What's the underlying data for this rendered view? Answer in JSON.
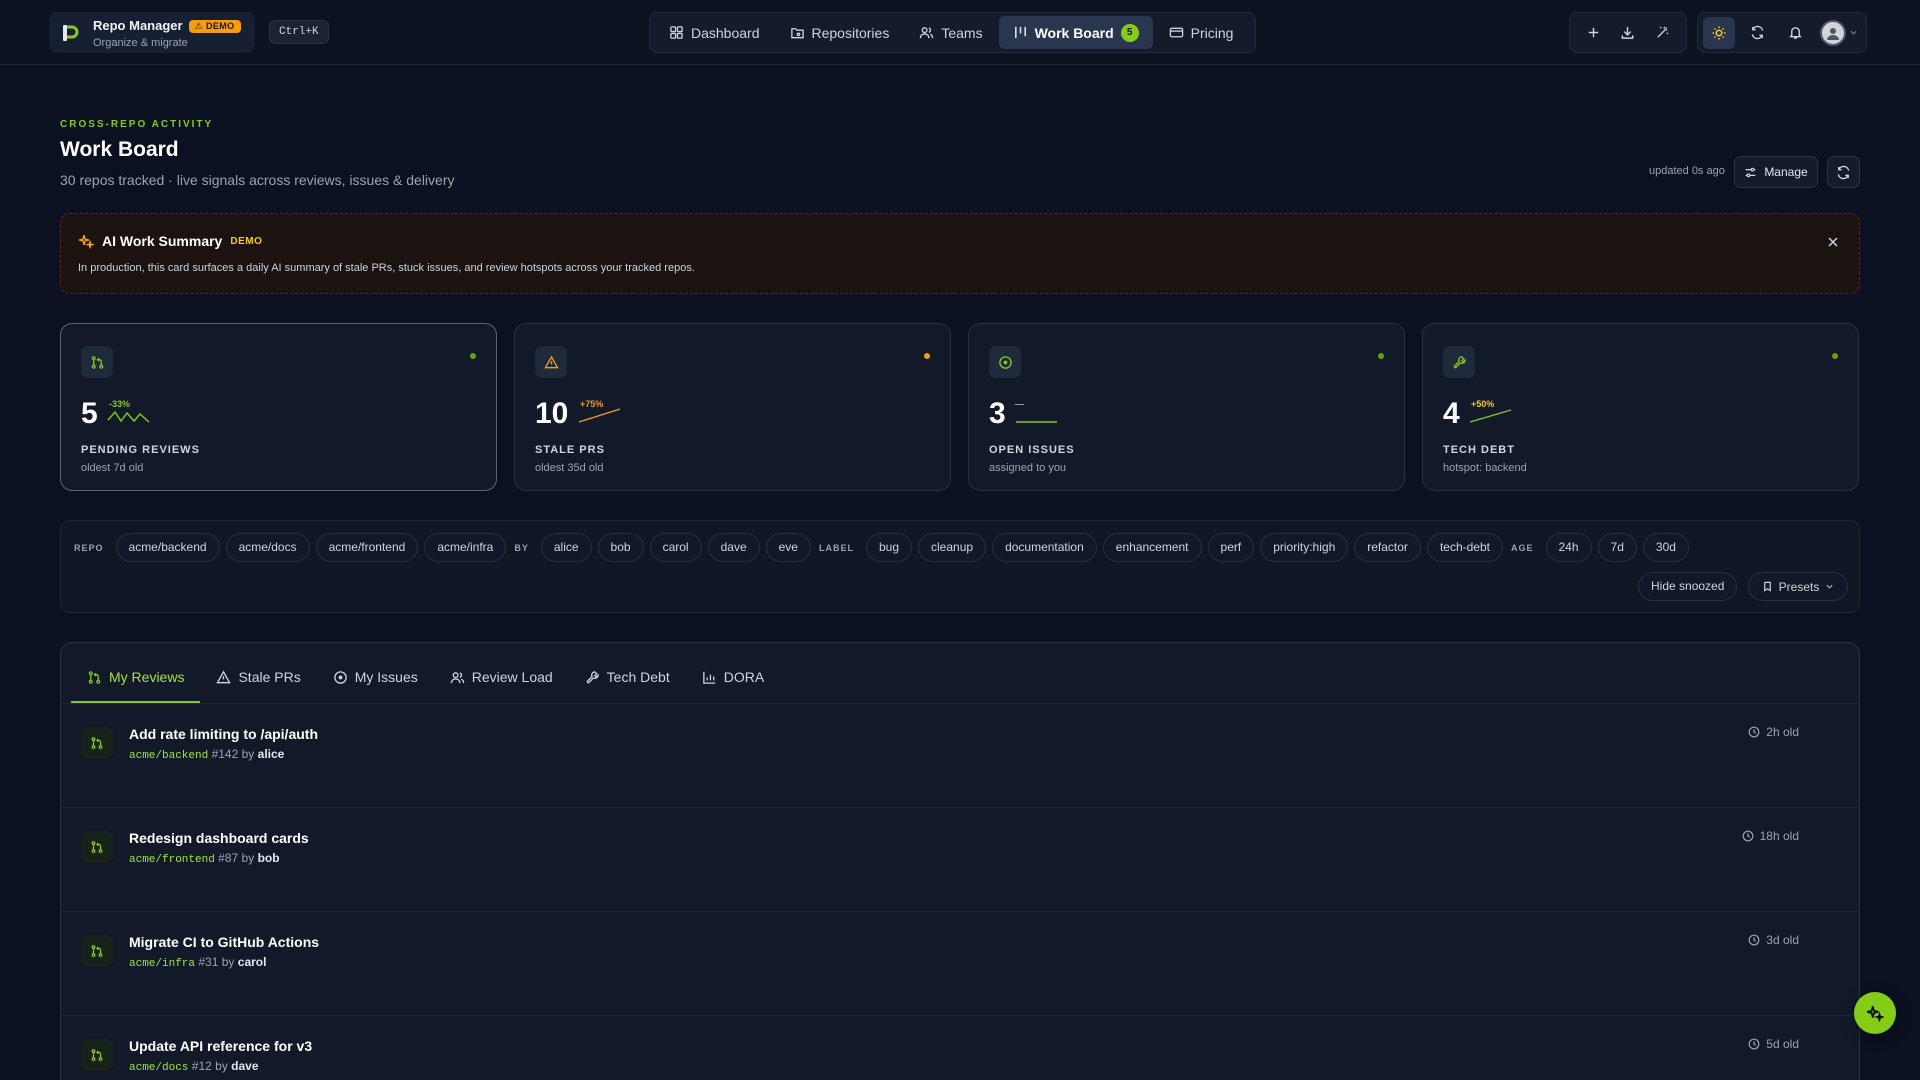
{
  "app": {
    "name": "Repo Manager",
    "tagline": "Organize & migrate",
    "demo_badge": "DEMO",
    "shortcut": "Ctrl+K"
  },
  "nav": {
    "items": [
      {
        "label": "Dashboard",
        "icon": "grid-icon"
      },
      {
        "label": "Repositories",
        "icon": "folder-git-icon"
      },
      {
        "label": "Teams",
        "icon": "users-icon"
      },
      {
        "label": "Work Board",
        "icon": "kanban-icon",
        "badge": "5",
        "active": true
      },
      {
        "label": "Pricing",
        "icon": "credit-card-icon"
      }
    ]
  },
  "header": {
    "eyebrow": "CROSS-REPO ACTIVITY",
    "title": "Work Board",
    "subtitle": "30 repos tracked · live signals across reviews, issues & delivery",
    "updated": "updated 0s ago",
    "manage_label": "Manage"
  },
  "ai_summary": {
    "title": "AI Work Summary",
    "badge": "DEMO",
    "body": "In production, this card surfaces a daily AI summary of stale PRs, stuck issues, and review hotspots across your tracked repos."
  },
  "stats": [
    {
      "value": "5",
      "delta": "-33%",
      "label": "PENDING REVIEWS",
      "note": "oldest 7d old",
      "icon": "git-pull-request-icon",
      "dot_color": "#65a30d",
      "delta_color": "#84cc16"
    },
    {
      "value": "10",
      "delta": "+75%",
      "label": "STALE PRS",
      "note": "oldest 35d old",
      "icon": "alert-triangle-icon",
      "dot_color": "#f59e0b",
      "delta_color": "#f59e0b"
    },
    {
      "value": "3",
      "delta": "—",
      "label": "OPEN ISSUES",
      "note": "assigned to you",
      "icon": "circle-dot-icon",
      "dot_color": "#65a30d",
      "delta_color": "#9ca3af"
    },
    {
      "value": "4",
      "delta": "+50%",
      "label": "TECH DEBT",
      "note": "hotspot: backend",
      "icon": "wrench-icon",
      "dot_color": "#65a30d",
      "delta_color": "#facc15"
    }
  ],
  "filters": {
    "repo_label": "REPO",
    "repos": [
      "acme/backend",
      "acme/docs",
      "acme/frontend",
      "acme/infra"
    ],
    "by_label": "BY",
    "authors": [
      "alice",
      "bob",
      "carol",
      "dave",
      "eve"
    ],
    "label_label": "LABEL",
    "labels": [
      "bug",
      "cleanup",
      "documentation",
      "enhancement",
      "perf",
      "priority:high",
      "refactor",
      "tech-debt"
    ],
    "age_label": "AGE",
    "ages": [
      "24h",
      "7d",
      "30d"
    ],
    "hide_snoozed": "Hide snoozed",
    "presets": "Presets"
  },
  "tabs": [
    {
      "label": "My Reviews",
      "icon": "git-pull-request-icon",
      "active": true
    },
    {
      "label": "Stale PRs",
      "icon": "alert-triangle-icon"
    },
    {
      "label": "My Issues",
      "icon": "circle-dot-icon"
    },
    {
      "label": "Review Load",
      "icon": "users-icon"
    },
    {
      "label": "Tech Debt",
      "icon": "wrench-icon"
    },
    {
      "label": "DORA",
      "icon": "bar-chart-icon"
    }
  ],
  "reviews": [
    {
      "title": "Add rate limiting to /api/auth",
      "repo": "acme/backend",
      "number": "#142",
      "by": "by",
      "author": "alice",
      "age": "2h old"
    },
    {
      "title": "Redesign dashboard cards",
      "repo": "acme/frontend",
      "number": "#87",
      "by": "by",
      "author": "bob",
      "age": "18h old"
    },
    {
      "title": "Migrate CI to GitHub Actions",
      "repo": "acme/infra",
      "number": "#31",
      "by": "by",
      "author": "carol",
      "age": "3d old"
    },
    {
      "title": "Update API reference for v3",
      "repo": "acme/docs",
      "number": "#12",
      "by": "by",
      "author": "dave",
      "age": "5d old"
    }
  ],
  "colors": {
    "accent": "#84cc16",
    "background": "#0b1120",
    "card": "#121a2a",
    "warning": "#f59e0b"
  }
}
